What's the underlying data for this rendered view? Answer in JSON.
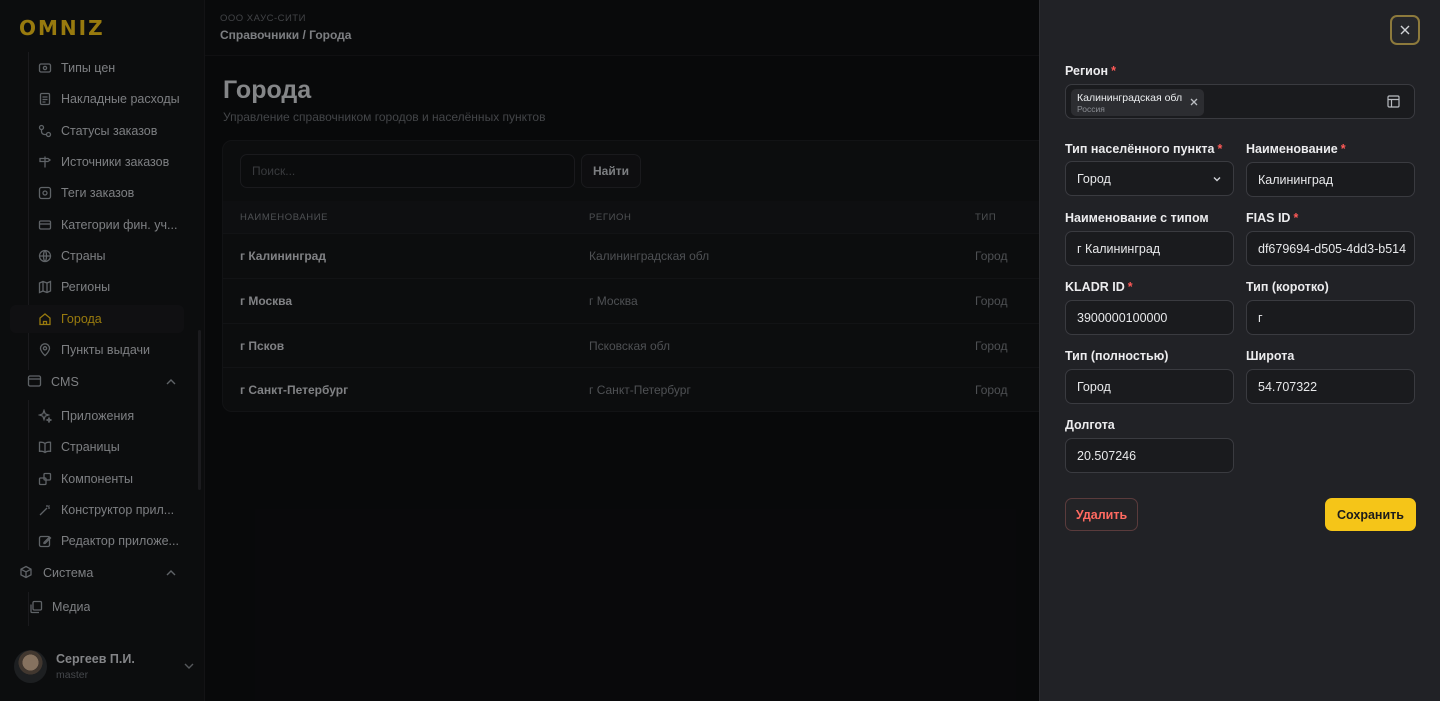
{
  "brand": {
    "logo": "OMNIZ",
    "accent": "#f5c518"
  },
  "sidebar": {
    "items": [
      {
        "label": "Типы цен",
        "icon": "price-tag-icon"
      },
      {
        "label": "Накладные расходы",
        "icon": "document-icon"
      },
      {
        "label": "Статусы заказов",
        "icon": "workflow-icon"
      },
      {
        "label": "Источники заказов",
        "icon": "signpost-icon"
      },
      {
        "label": "Теги заказов",
        "icon": "tag-icon"
      },
      {
        "label": "Категории фин. уч...",
        "icon": "card-icon"
      },
      {
        "label": "Страны",
        "icon": "globe-icon"
      },
      {
        "label": "Регионы",
        "icon": "map-icon"
      },
      {
        "label": "Города",
        "icon": "building-icon"
      },
      {
        "label": "Пункты выдачи",
        "icon": "pin-icon"
      }
    ],
    "active_index": 8,
    "group_cms": "CMS",
    "cms_items": [
      {
        "label": "Приложения",
        "icon": "sparkle-icon"
      },
      {
        "label": "Страницы",
        "icon": "book-icon"
      },
      {
        "label": "Компоненты",
        "icon": "component-icon"
      },
      {
        "label": "Конструктор прил...",
        "icon": "wand-icon"
      },
      {
        "label": "Редактор приложе...",
        "icon": "edit-icon"
      }
    ],
    "group_system": "Система",
    "system_items": [
      {
        "label": "Медиа",
        "icon": "media-icon"
      }
    ],
    "user": {
      "name": "Сергеев П.И.",
      "role": "master"
    }
  },
  "header": {
    "org": "ООО ХАУС-СИТИ",
    "breadcrumb": "Справочники / Города"
  },
  "main": {
    "title": "Города",
    "subtitle": "Управление справочником городов и населённых пунктов",
    "search_placeholder": "Поиск...",
    "find_label": "Найти",
    "columns": [
      "НАИМЕНОВАНИЕ",
      "РЕГИОН",
      "ТИП"
    ],
    "rows": [
      {
        "name": "г Калининград",
        "region": "Калининградская обл",
        "type": "Город"
      },
      {
        "name": "г Москва",
        "region": "г Москва",
        "type": "Город"
      },
      {
        "name": "г Псков",
        "region": "Псковская обл",
        "type": "Город"
      },
      {
        "name": "г Санкт-Петербург",
        "region": "г Санкт-Петербург",
        "type": "Город"
      }
    ]
  },
  "drawer": {
    "region_label": "Регион",
    "region_value": "Калининградская обл",
    "region_country": "Россия",
    "settlement_type_label": "Тип населённого пункта",
    "settlement_type_value": "Город",
    "name_label": "Наименование",
    "name_value": "Калининград",
    "name_with_type_label": "Наименование с типом",
    "name_with_type_value": "г Калининград",
    "fias_label": "FIAS ID",
    "fias_value": "df679694-d505-4dd3-b514",
    "kladr_label": "KLADR ID",
    "kladr_value": "3900000100000",
    "type_short_label": "Тип (коротко)",
    "type_short_value": "г",
    "type_full_label": "Тип (полностью)",
    "type_full_value": "Город",
    "lat_label": "Широта",
    "lat_value": "54.707322",
    "lon_label": "Долгота",
    "lon_value": "20.507246",
    "required_mark": "*",
    "delete_label": "Удалить",
    "save_label": "Сохранить"
  }
}
